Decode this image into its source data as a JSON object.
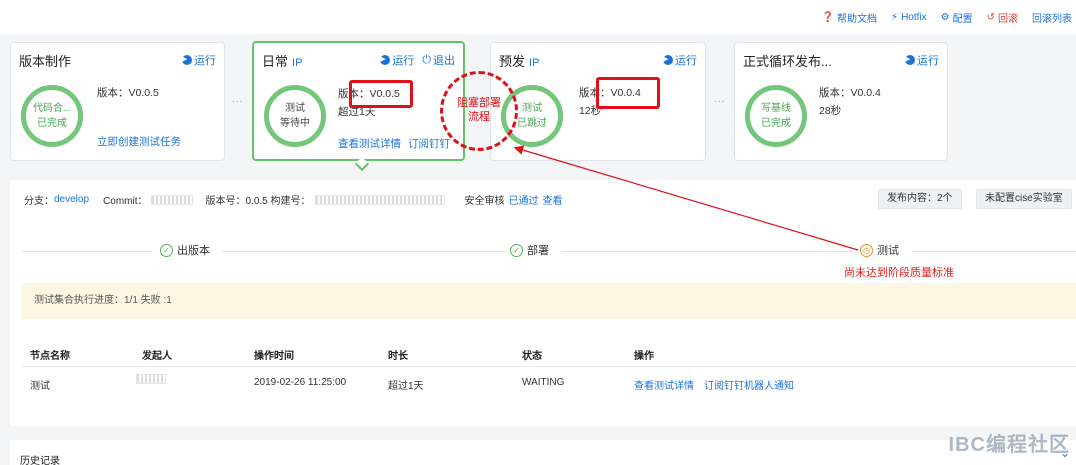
{
  "toolbar": {
    "help": "帮助文档",
    "hotfix": "Hotfix",
    "config": "配置",
    "rollback": "回滚",
    "rollback_list": "回滚列表",
    "colors": {
      "link": "#1a73d9",
      "danger": "#e0403a"
    }
  },
  "pipeline": {
    "build": {
      "title": "版本制作",
      "run": "运行",
      "status_line1": "代码合...",
      "status_line2": "已完成",
      "version": "版本：V0.0.5",
      "link": "立即创建测试任务"
    },
    "daily": {
      "title": "日常",
      "tag": "IP",
      "run": "运行",
      "exit": "退出",
      "status_line1": "测试",
      "status_line2": "等待中",
      "version_label": "版本：",
      "version_value": "V0.0.5",
      "duration": "超过1天",
      "link_detail": "查看测试详情",
      "link_subscribe": "订阅钉钉"
    },
    "pre": {
      "title": "预发",
      "tag": "IP",
      "run": "运行",
      "status_line1": "测试",
      "status_line2": "已跳过",
      "version_label": "版本：",
      "version_value": "V0.0.4",
      "duration": "12秒"
    },
    "release": {
      "title": "正式循环发布...",
      "run": "运行",
      "status_line1": "写基线",
      "status_line2": "已完成",
      "version": "版本：V0.0.4",
      "duration": "28秒"
    },
    "ellipsis": "...",
    "accent_color": "#62c36a"
  },
  "detail": {
    "branch_label": "分支：",
    "branch_value": "develop",
    "commit_label": "Commit：",
    "version_label": "版本号：0.0.5 构建号：",
    "security_label": "安全审核",
    "security_status": "已通过",
    "security_view": "查看",
    "release_content_button": "发布内容：2个",
    "cise_button": "未配置cise实验室"
  },
  "steps": [
    {
      "label": "出版本",
      "state": "done"
    },
    {
      "label": "部署",
      "state": "done"
    },
    {
      "label": "测试",
      "state": "waiting"
    }
  ],
  "step_warning": "尚未达到阶段质量标准",
  "notice": "测试集合执行进度：1/1 失败 :1",
  "table": {
    "columns": [
      "节点名称",
      "发起人",
      "操作时间",
      "时长",
      "状态",
      "操作"
    ],
    "rows": [
      {
        "node": "测试",
        "time": "2019-02-26 11:25:00",
        "duration": "超过1天",
        "status": "WAITING",
        "action_detail": "查看测试详情",
        "action_subscribe": "订阅钉钉机器人通知"
      }
    ]
  },
  "history": {
    "title": "历史记录"
  },
  "annotation": {
    "text": "阻塞部署流程"
  },
  "watermark": "IBC编程社区"
}
